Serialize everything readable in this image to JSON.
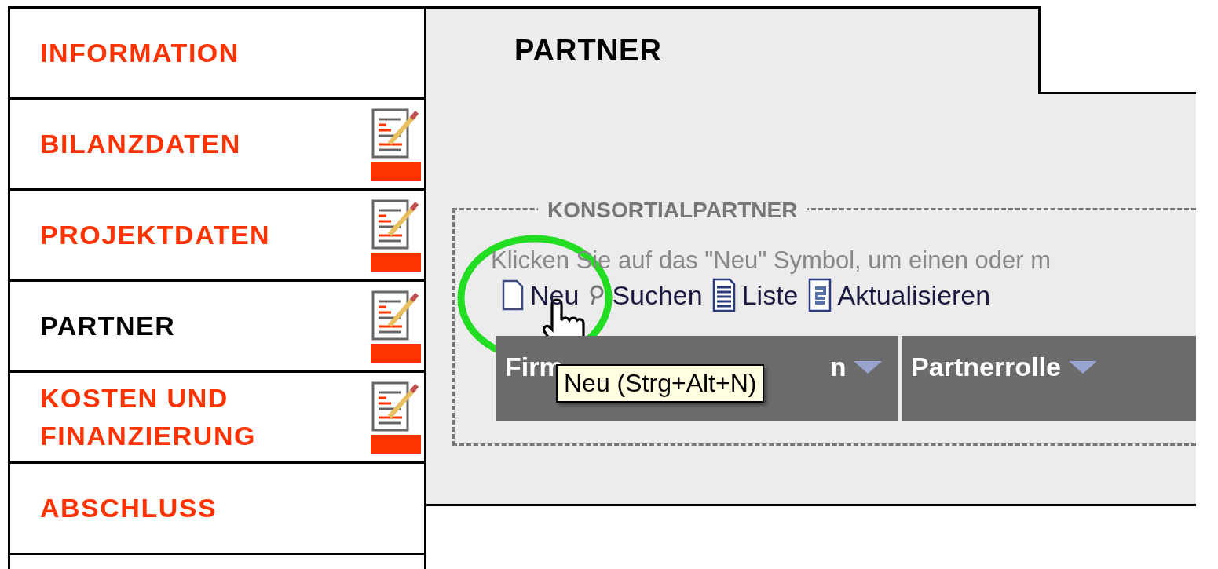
{
  "sidebar": {
    "items": [
      {
        "label": "INFORMATION",
        "selected": false,
        "edited": false
      },
      {
        "label": "BILANZDATEN",
        "selected": false,
        "edited": true
      },
      {
        "label": "PROJEKTDATEN",
        "selected": false,
        "edited": true
      },
      {
        "label": "PARTNER",
        "selected": true,
        "edited": true
      },
      {
        "label": "KOSTEN UND FINANZIERUNG",
        "selected": false,
        "edited": true
      },
      {
        "label": "ABSCHLUSS",
        "selected": false,
        "edited": false
      }
    ]
  },
  "tab": {
    "label": "PARTNER"
  },
  "section": {
    "legend": "KONSORTIALPARTNER",
    "hint": "Klicken Sie auf das \"Neu\" Symbol, um einen oder m",
    "toolbar": [
      {
        "kind": "new",
        "label": "Neu"
      },
      {
        "kind": "search",
        "label": "Suchen"
      },
      {
        "kind": "list",
        "label": "Liste"
      },
      {
        "kind": "refresh",
        "label": "Aktualisieren"
      }
    ],
    "table": {
      "columns": [
        {
          "label_start": "Firm",
          "label_end": "n"
        },
        {
          "label_start": "Partnerrolle"
        }
      ]
    }
  },
  "tooltip": "Neu (Strg+Alt+N)"
}
